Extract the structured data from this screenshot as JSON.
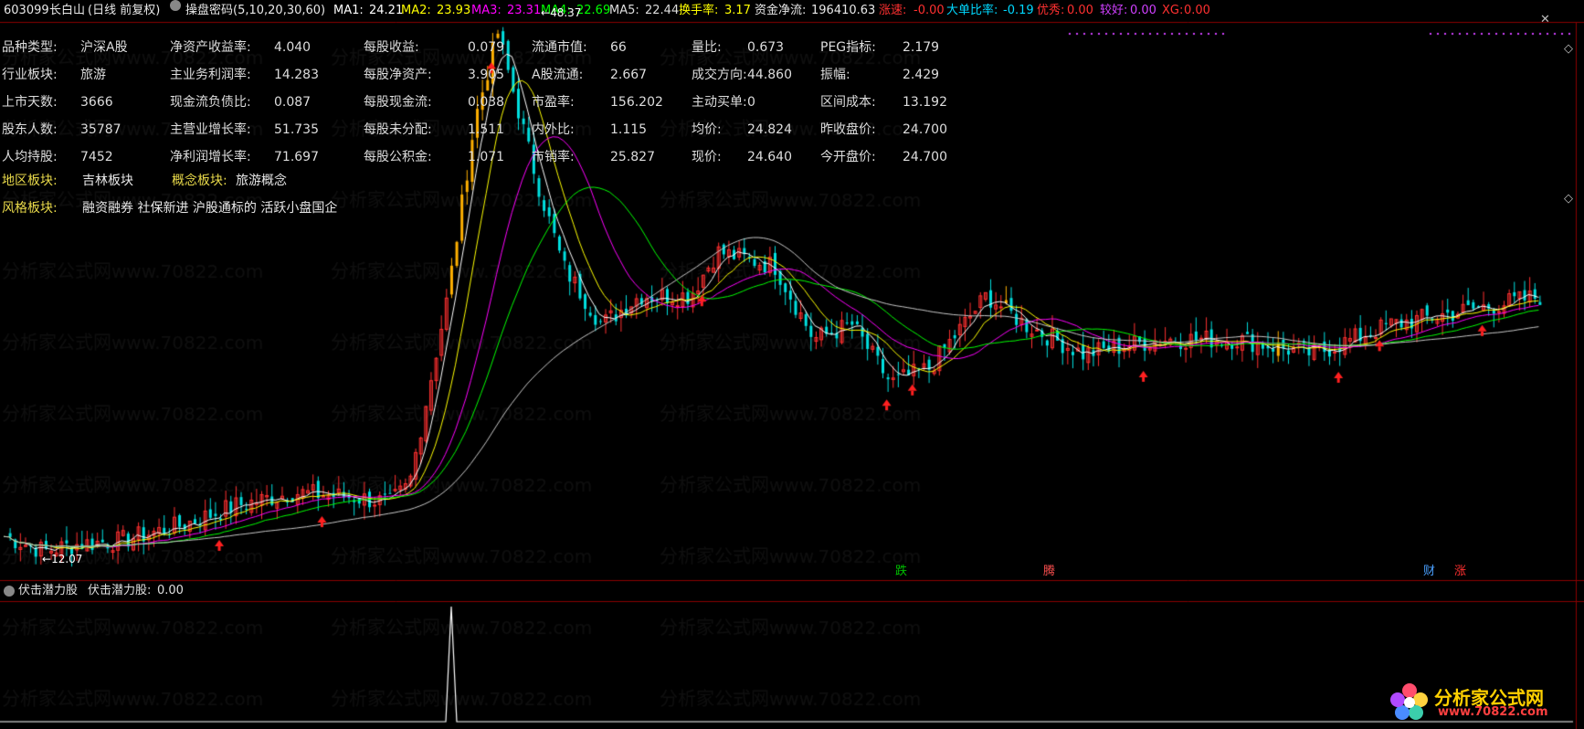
{
  "header": {
    "code": "603099",
    "name": "长白山",
    "period": "(日线 前复权)",
    "indicator": "操盘密码(5,10,20,30,60)",
    "ma": [
      {
        "label": "MA1:",
        "value": "24.21",
        "color": "#ffffff"
      },
      {
        "label": "MA2:",
        "value": "23.93",
        "color": "#ffff00"
      },
      {
        "label": "MA3:",
        "value": "23.31",
        "color": "#ff00ff"
      },
      {
        "label": "MA4:",
        "value": "22.69",
        "color": "#00ff00"
      },
      {
        "label": "MA5:",
        "value": "22.44",
        "color": "#c8c8c8"
      }
    ],
    "turnover_label": "换手率:",
    "turnover_value": "3.17",
    "fund_label": "资金净流:",
    "fund_value": "196410.63",
    "speed_label": "涨速:",
    "speed_value": "-0.00",
    "bigorder_label": "大单比率:",
    "bigorder_value": "-0.19",
    "excellent_label": "优秀:",
    "excellent_value": "0.00",
    "good_label": "较好:",
    "good_value": "0.00",
    "xg_label": "XG:",
    "xg_value": "0.00"
  },
  "info_rows": [
    [
      {
        "label": "品种类型:",
        "value": "沪深A股"
      },
      {
        "label": "净资产收益率:",
        "value": "4.040"
      },
      {
        "label": "每股收益:",
        "value": "0.079"
      },
      {
        "label": "流通市值:",
        "value": "66"
      },
      {
        "label": "量比:",
        "value": "0.673"
      },
      {
        "label": "PEG指标:",
        "value": "2.179"
      }
    ],
    [
      {
        "label": "行业板块:",
        "value": "旅游"
      },
      {
        "label": "主业务利润率:",
        "value": "14.283"
      },
      {
        "label": "每股净资产:",
        "value": "3.905"
      },
      {
        "label": "A股流通:",
        "value": "2.667"
      },
      {
        "label": "成交方向:",
        "value": "44.860"
      },
      {
        "label": "振幅:",
        "value": "2.429"
      }
    ],
    [
      {
        "label": "上市天数:",
        "value": "3666"
      },
      {
        "label": "现金流负债比:",
        "value": "0.087"
      },
      {
        "label": "每股现金流:",
        "value": "0.038"
      },
      {
        "label": "市盈率:",
        "value": "156.202"
      },
      {
        "label": "主动买单:",
        "value": "0"
      },
      {
        "label": "区间成本:",
        "value": "13.192"
      }
    ],
    [
      {
        "label": "股东人数:",
        "value": "35787"
      },
      {
        "label": "主营业增长率:",
        "value": "51.735"
      },
      {
        "label": "每股未分配:",
        "value": "1.511"
      },
      {
        "label": "内外比:",
        "value": "1.115"
      },
      {
        "label": "均价:",
        "value": "24.824"
      },
      {
        "label": "昨收盘价:",
        "value": "24.700"
      }
    ],
    [
      {
        "label": "人均持股:",
        "value": "7452"
      },
      {
        "label": "净利润增长率:",
        "value": "71.697"
      },
      {
        "label": "每股公积金:",
        "value": "1.071"
      },
      {
        "label": "市销率:",
        "value": "25.827"
      },
      {
        "label": "现价:",
        "value": "24.640"
      },
      {
        "label": "今开盘价:",
        "value": "24.700"
      }
    ]
  ],
  "region": {
    "label": "地区板块:",
    "value": "吉林板块",
    "concept_label": "概念板块:",
    "concept_value": "旅游概念"
  },
  "style": {
    "label": "风格板块:",
    "value": "融资融券 社保新进 沪股通标的 活跃小盘国企"
  },
  "price_marks": {
    "high": "48.37",
    "low": "12.07"
  },
  "badges": [
    {
      "text": "跌",
      "color": "#00c000"
    },
    {
      "text": "腾",
      "color": "#ff5050"
    },
    {
      "text": "财",
      "color": "#4aa0ff"
    },
    {
      "text": "涨",
      "color": "#ff3030"
    }
  ],
  "sub": {
    "title": "伏击潜力股",
    "label": "伏击潜力股:",
    "value": "0.00"
  },
  "watermark": "分析家公式网www.70822.com",
  "logo": {
    "text": "分析家公式网",
    "url": "www.70822.com"
  },
  "chart_data": {
    "type": "candlestick",
    "high": 48.37,
    "low": 12.07,
    "ma_periods": [
      5,
      10,
      20,
      30,
      60
    ],
    "ma_colors": [
      "#ffffff",
      "#ffff00",
      "#ff00ff",
      "#00ff00",
      "#c8c8c8"
    ],
    "sub_indicator": {
      "name": "伏击潜力股",
      "spike_at_fraction": 0.285
    }
  }
}
